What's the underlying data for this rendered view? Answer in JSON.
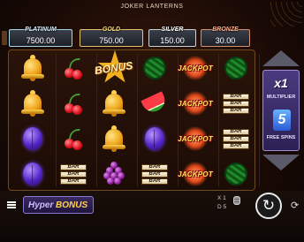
{
  "title": "JOKER LANTERNS",
  "jackpots": [
    {
      "name": "PLATINUM",
      "value": "7500.00"
    },
    {
      "name": "GOLD",
      "value": "750.00"
    },
    {
      "name": "SILVER",
      "value": "150.00"
    },
    {
      "name": "BRONZE",
      "value": "30.00"
    }
  ],
  "reels": [
    [
      "bell",
      "bell",
      "plum",
      "plum"
    ],
    [
      "cherry",
      "cherry",
      "cherry",
      "bar"
    ],
    [
      "bonus",
      "bell",
      "bell",
      "grapes"
    ],
    [
      "melon",
      "melon-slice",
      "plum",
      "bar"
    ],
    [
      "jackpot",
      "jackpot",
      "jackpot",
      "jackpot"
    ],
    [
      "melon",
      "bar",
      "bar",
      "melon"
    ]
  ],
  "symbol_text": {
    "bonus": "BONUS",
    "jackpot": "JACKPOT",
    "bar": "BAR"
  },
  "multiplier": {
    "value": "x1",
    "label": "MULTIPLIER"
  },
  "free_spins": {
    "value": "5",
    "label": "FREE SPINS"
  },
  "logo": {
    "part1": "Hyper",
    "part2": "BONUS"
  },
  "controls": {
    "lines_label": "X 1",
    "coin_label": "D 5"
  },
  "icons": [
    "menu-icon",
    "coin-stack-icon",
    "spin-icon",
    "autoplay-icon"
  ]
}
